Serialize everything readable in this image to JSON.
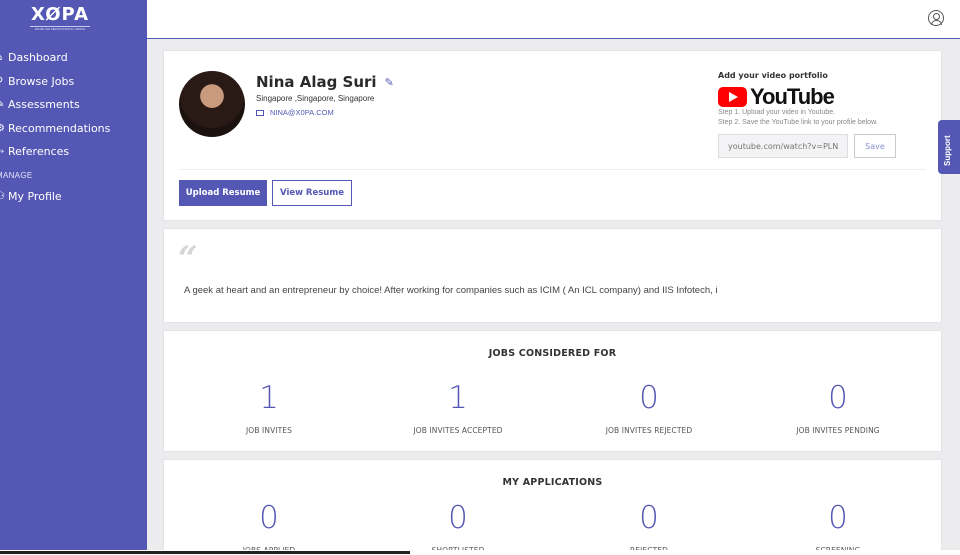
{
  "app": {
    "logo_text": "XØPA",
    "logo_sub": "ENABLING MERITOCRATIC HIRING"
  },
  "sidebar": {
    "items": [
      {
        "label": "Dashboard",
        "icon": "home-icon",
        "glyph": "⌂"
      },
      {
        "label": "Browse Jobs",
        "icon": "search-icon",
        "glyph": "⚲"
      },
      {
        "label": "Assessments",
        "icon": "edit-icon",
        "glyph": "✎"
      },
      {
        "label": "Recommendations",
        "icon": "gear-icon",
        "glyph": "⚙"
      },
      {
        "label": "References",
        "icon": "share-icon",
        "glyph": "⤳"
      }
    ],
    "section_label": "MANAGE",
    "manage_items": [
      {
        "label": "My Profile",
        "icon": "user-icon",
        "glyph": "⚇"
      }
    ]
  },
  "profile": {
    "name": "Nina Alag Suri",
    "location": "Singapore ,Singapore, Singapore",
    "email": "NINA@X0PA.COM",
    "upload_label": "Upload Resume",
    "view_label": "View Resume"
  },
  "youtube": {
    "title": "Add your video portfolio",
    "brand": "YouTube",
    "step1": "Step 1. Upload your video in Youtube.",
    "step2": "Step 2. Save the YouTube link to your profile below.",
    "placeholder": "youtube.com/watch?v=PLN",
    "save_label": "Save"
  },
  "about": {
    "quote": "“",
    "text": "A geek at heart and an entrepreneur by choice! After working for companies such as ICIM ( An ICL company) and IIS Infotech, i"
  },
  "jobs_considered": {
    "title": "JOBS CONSIDERED FOR",
    "stats": [
      {
        "value": "1",
        "label": "JOB INVITES"
      },
      {
        "value": "1",
        "label": "JOB INVITES ACCEPTED"
      },
      {
        "value": "0",
        "label": "JOB INVITES REJECTED"
      },
      {
        "value": "0",
        "label": "JOB INVITES PENDING"
      }
    ]
  },
  "my_applications": {
    "title": "MY APPLICATIONS",
    "stats": [
      {
        "value": "0",
        "label": "JOBS APPLIED"
      },
      {
        "value": "0",
        "label": "SHORTLISTED"
      },
      {
        "value": "0",
        "label": "REJECTED"
      },
      {
        "value": "0",
        "label": "SCREENING"
      }
    ]
  },
  "support": {
    "label": "Support"
  },
  "colors": {
    "brand": "#5458b4",
    "youtube_red": "#ff0000"
  }
}
